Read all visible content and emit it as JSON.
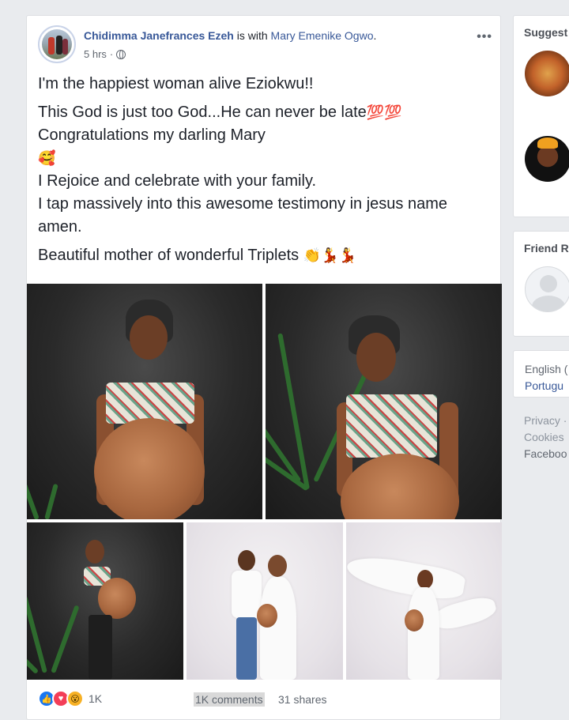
{
  "post": {
    "author": "Chidimma Janefrances Ezeh",
    "with_text": " is with ",
    "with_name": "Mary Emenike Ogwo",
    "with_end": ".",
    "time": "5 hrs",
    "privacy_icon": "globe-icon",
    "more_label": "•••",
    "lines": [
      "I'm the happiest woman alive Eziokwu!!",
      "This God is just too God...He can never be late",
      "Congratulations my darling Mary",
      "I Rejoice and celebrate with your family.",
      "I tap massively into this awesome testimony in jesus name amen.",
      "Beautiful mother of wonderful Triplets"
    ],
    "emojis": {
      "hundred": "💯💯",
      "hearts_face": "🥰",
      "clap_dance": "👏💃💃"
    }
  },
  "photos": [
    {
      "id": "photo-1",
      "style": "dark"
    },
    {
      "id": "photo-2",
      "style": "dark"
    },
    {
      "id": "photo-3",
      "style": "dark"
    },
    {
      "id": "photo-4",
      "style": "light"
    },
    {
      "id": "photo-5",
      "style": "light"
    }
  ],
  "reactions": {
    "icons": [
      "like-icon",
      "love-icon",
      "wow-icon"
    ],
    "count": "1K",
    "comments": "1K comments",
    "shares": "31 shares"
  },
  "sidebar": {
    "suggested_title": "Suggest",
    "friend_title": "Friend R",
    "languages": {
      "current": "English (",
      "alt": "Portugu"
    },
    "footer": [
      "Privacy ·",
      "Cookies",
      "Faceboo"
    ]
  },
  "colors": {
    "link": "#385898",
    "like": "#1877f2",
    "love": "#f33e58",
    "wow": "#f7b125"
  }
}
